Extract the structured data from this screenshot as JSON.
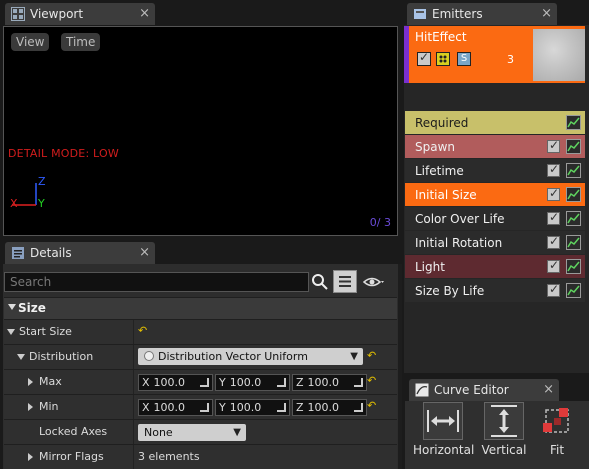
{
  "viewport": {
    "tab_label": "Viewport",
    "view_button": "View",
    "time_button": "Time",
    "detail_mode": "DETAIL MODE: LOW",
    "frame_counter": "0/  3",
    "axis_x": "X",
    "axis_y": "Y",
    "axis_z": "Z"
  },
  "emitters": {
    "tab_label": "Emitters",
    "emitter_name": "HitEffect",
    "emitter_count": "3",
    "solo_label": "S",
    "modules": [
      {
        "label": "Required",
        "bg": "#c8c06a",
        "fg": "#1b1b1b",
        "checkbox": false
      },
      {
        "label": "Spawn",
        "bg": "#b15c5c",
        "fg": "#f0f0f0",
        "checkbox": true
      },
      {
        "label": "Lifetime",
        "bg": "#2b2b2b",
        "fg": "#f0f0f0",
        "checkbox": true
      },
      {
        "label": "Initial Size",
        "bg": "#fb6a12",
        "fg": "#ffffff",
        "checkbox": true
      },
      {
        "label": "Color Over Life",
        "bg": "#2b2b2b",
        "fg": "#f0f0f0",
        "checkbox": true
      },
      {
        "label": "Initial Rotation",
        "bg": "#2b2b2b",
        "fg": "#f0f0f0",
        "checkbox": true
      },
      {
        "label": "Light",
        "bg": "#5e2a30",
        "fg": "#f0f0f0",
        "checkbox": true
      },
      {
        "label": "Size By Life",
        "bg": "#2b2b2b",
        "fg": "#f0f0f0",
        "checkbox": true
      }
    ]
  },
  "details": {
    "tab_label": "Details",
    "search_placeholder": "Search",
    "section_title": "Size",
    "start_size_label": "Start Size",
    "distribution_label": "Distribution",
    "distribution_value": "Distribution Vector Uniform",
    "max_label": "Max",
    "min_label": "Min",
    "max": {
      "x": "100.0",
      "y": "100.0",
      "z": "100.0"
    },
    "min": {
      "x": "100.0",
      "y": "100.0",
      "z": "100.0"
    },
    "locked_axes_label": "Locked Axes",
    "locked_axes_value": "None",
    "mirror_flags_label": "Mirror Flags",
    "mirror_flags_value": "3 elements",
    "x_label": "X",
    "y_label": "Y",
    "z_label": "Z"
  },
  "curve_editor": {
    "tab_label": "Curve Editor",
    "horizontal_label": "Horizontal",
    "vertical_label": "Vertical",
    "fit_label": "Fit"
  }
}
